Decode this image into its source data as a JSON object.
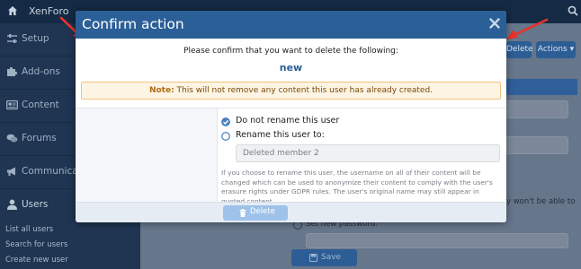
{
  "app": {
    "brand": "XenForo"
  },
  "sidebar": {
    "items": [
      {
        "label": "Setup",
        "icon": "sliders-icon"
      },
      {
        "label": "Add-ons",
        "icon": "puzzle-icon"
      },
      {
        "label": "Content",
        "icon": "newspaper-icon"
      },
      {
        "label": "Forums",
        "icon": "comments-icon"
      },
      {
        "label": "Communication",
        "icon": "bullhorn-icon"
      },
      {
        "label": "Users",
        "icon": "user-icon"
      }
    ],
    "sub_items": [
      "List all users",
      "Search for users",
      "Create new user"
    ]
  },
  "header": {
    "delete_label": "Delete",
    "actions_label": "Actions ▾"
  },
  "background": {
    "partial_text_1": "y won't be able to",
    "partial_text_2": "Set new password:",
    "save_label": "Save"
  },
  "modal": {
    "title": "Confirm action",
    "confirm_text": "Please confirm that you want to delete the following:",
    "target_name": "new",
    "note_label": "Note:",
    "note_text": " This will not remove any content this user has already created.",
    "option_keep": "Do not rename this user",
    "option_rename": "Rename this user to:",
    "rename_value": "Deleted member 2",
    "explanation": "If you choose to rename this user, the username on all of their content will be changed which can be used to anonymize their content to comply with the user's erasure rights under GDPR rules. The user's original name may still appear in quoted content.",
    "delete_label": "Delete"
  },
  "colors": {
    "accent": "#2b5f97",
    "note_bg": "#fdf4e3",
    "note_border": "#f0c37c",
    "delete_button": "#9fc2ea",
    "annotation_arrow": "#e8322b"
  }
}
